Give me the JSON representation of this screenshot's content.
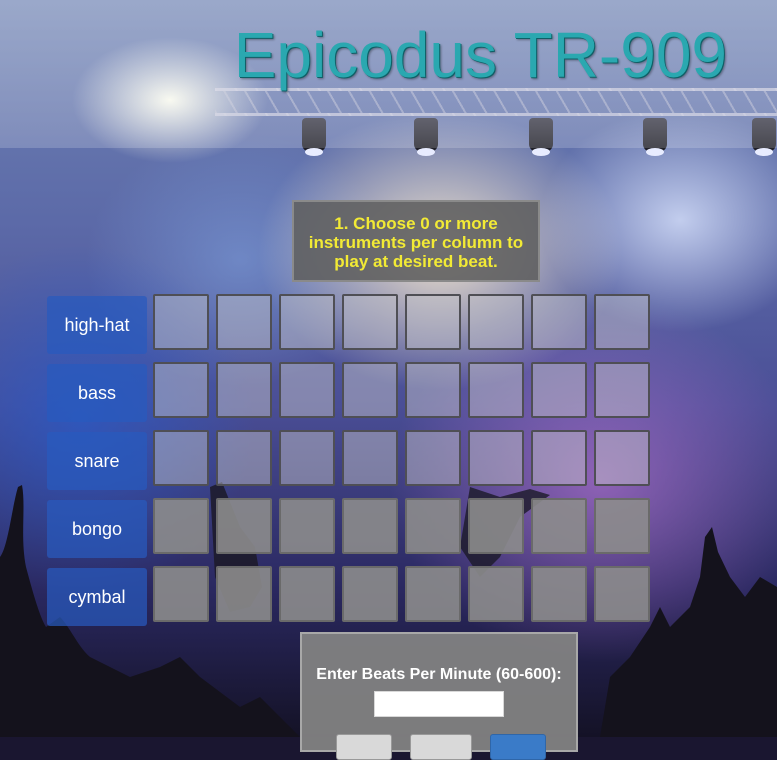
{
  "header": {
    "title": "Epicodus TR-909"
  },
  "instructions": {
    "text": "1. Choose 0 or more instruments per column to play at desired beat."
  },
  "sequencer": {
    "instruments": [
      {
        "label": "high-hat"
      },
      {
        "label": "bass"
      },
      {
        "label": "snare"
      },
      {
        "label": "bongo"
      },
      {
        "label": "cymbal"
      }
    ],
    "beats_per_row": 8
  },
  "bpm": {
    "label": "Enter Beats Per Minute (60-600):",
    "value": ""
  },
  "colors": {
    "title": "#2aa8b0",
    "instructions_text": "#f2ea35",
    "instrument_label_bg": "#285abe"
  }
}
